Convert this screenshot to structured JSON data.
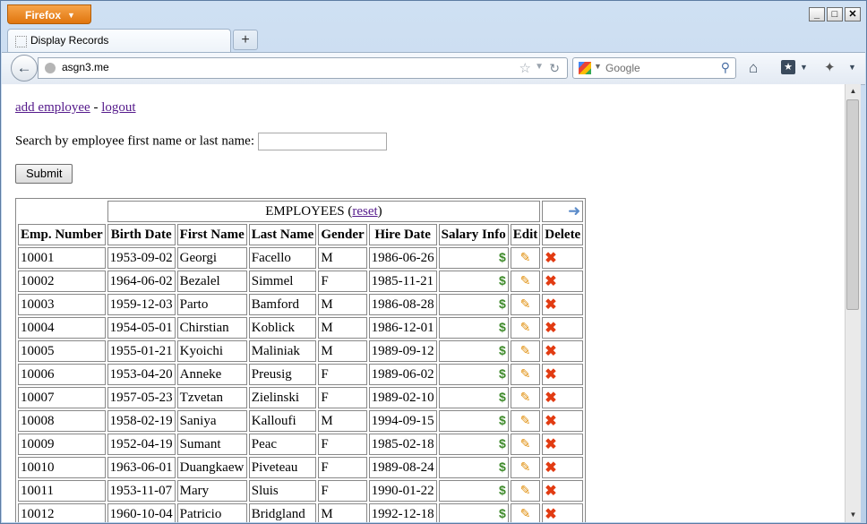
{
  "browser": {
    "app_button": "Firefox",
    "window_buttons": {
      "minimize": "_",
      "maximize": "□",
      "close": "✕"
    },
    "tab_title": "Display Records",
    "new_tab": "+",
    "url": "asgn3.me",
    "search_placeholder": "Google",
    "icons": [
      "back-icon",
      "globe-icon",
      "star-icon",
      "reload-icon",
      "google-icon",
      "search-icon",
      "home-icon",
      "bookmark-icon",
      "addon-icon"
    ]
  },
  "page": {
    "links": {
      "add": "add employee",
      "separator": " - ",
      "logout": "logout"
    },
    "search_label": "Search by employee first name or last name:",
    "search_value": "",
    "submit_label": "Submit",
    "table": {
      "caption": "EMPLOYEES",
      "caption_open": " (",
      "reset": "reset",
      "caption_close": ")",
      "headers": [
        "Emp. Number",
        "Birth Date",
        "First Name",
        "Last Name",
        "Gender",
        "Hire Date",
        "Salary Info",
        "Edit",
        "Delete"
      ],
      "rows": [
        [
          "10001",
          "1953-09-02",
          "Georgi",
          "Facello",
          "M",
          "1986-06-26"
        ],
        [
          "10002",
          "1964-06-02",
          "Bezalel",
          "Simmel",
          "F",
          "1985-11-21"
        ],
        [
          "10003",
          "1959-12-03",
          "Parto",
          "Bamford",
          "M",
          "1986-08-28"
        ],
        [
          "10004",
          "1954-05-01",
          "Chirstian",
          "Koblick",
          "M",
          "1986-12-01"
        ],
        [
          "10005",
          "1955-01-21",
          "Kyoichi",
          "Maliniak",
          "M",
          "1989-09-12"
        ],
        [
          "10006",
          "1953-04-20",
          "Anneke",
          "Preusig",
          "F",
          "1989-06-02"
        ],
        [
          "10007",
          "1957-05-23",
          "Tzvetan",
          "Zielinski",
          "F",
          "1989-02-10"
        ],
        [
          "10008",
          "1958-02-19",
          "Saniya",
          "Kalloufi",
          "M",
          "1994-09-15"
        ],
        [
          "10009",
          "1952-04-19",
          "Sumant",
          "Peac",
          "F",
          "1985-02-18"
        ],
        [
          "10010",
          "1963-06-01",
          "Duangkaew",
          "Piveteau",
          "F",
          "1989-08-24"
        ],
        [
          "10011",
          "1953-11-07",
          "Mary",
          "Sluis",
          "F",
          "1990-01-22"
        ],
        [
          "10012",
          "1960-10-04",
          "Patricio",
          "Bridgland",
          "M",
          "1992-12-18"
        ]
      ]
    }
  },
  "colors": {
    "accent": "#e0750e",
    "link": "#551a8b"
  }
}
